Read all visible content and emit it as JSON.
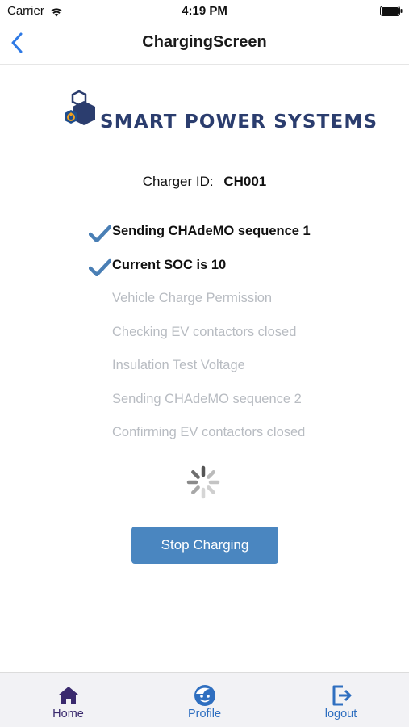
{
  "status_bar": {
    "carrier": "Carrier",
    "time": "4:19 PM"
  },
  "nav": {
    "title": "ChargingScreen",
    "back_icon": "chevron-left-icon"
  },
  "logo": {
    "text": "SMART POWER SYSTEMS"
  },
  "charger": {
    "label": "Charger ID:",
    "value": "CH001"
  },
  "steps": [
    {
      "label": "Sending CHAdeMO sequence 1",
      "status": "done"
    },
    {
      "label": "Current SOC is 10",
      "status": "done"
    },
    {
      "label": "Vehicle Charge Permission",
      "status": "pending"
    },
    {
      "label": "Checking EV contactors closed",
      "status": "pending"
    },
    {
      "label": "Insulation Test Voltage",
      "status": "pending"
    },
    {
      "label": "Sending CHAdeMO sequence 2",
      "status": "pending"
    },
    {
      "label": "Confirming EV contactors closed",
      "status": "pending"
    }
  ],
  "actions": {
    "stop_label": "Stop Charging"
  },
  "tabs": {
    "home": "Home",
    "profile": "Profile",
    "logout": "logout"
  },
  "colors": {
    "accent": "#4a86c0",
    "check": "#4a7fb5",
    "pending_text": "#b8bcc2",
    "nav_blue": "#2f7ae5",
    "home_tab": "#3a2a6e"
  }
}
